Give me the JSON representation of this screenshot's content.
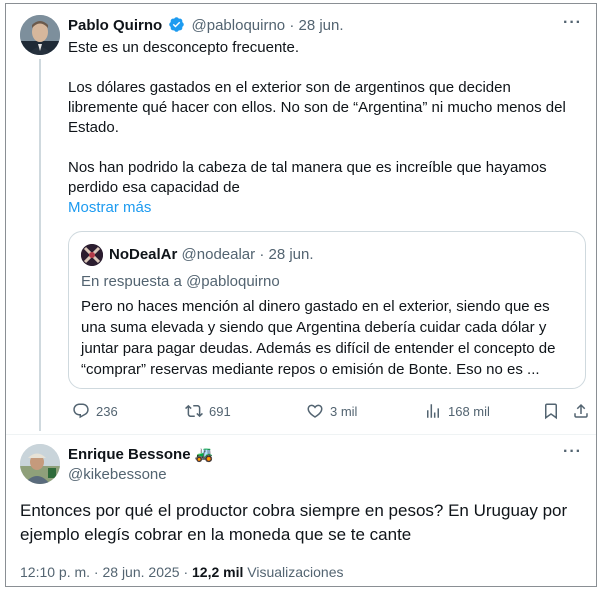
{
  "parent": {
    "name": "Pablo Quirno",
    "handle": "@pabloquirno",
    "sep": "·",
    "date": "28 jun.",
    "text_p1": "Este es un desconcepto frecuente.",
    "text_p2": "Los dólares gastados en el exterior son de argentinos que deciden libremente qué hacer con ellos. No son de “Argentina” ni mucho menos del Estado.",
    "text_p3": "Nos han podrido la cabeza de tal manera que es increíble que hayamos perdido esa capacidad de",
    "show_more": "Mostrar más",
    "more_icon": "more-icon",
    "verified_color": "#1d9bf0"
  },
  "quote": {
    "name": "NoDealAr",
    "handle": "@nodealar",
    "sep": "·",
    "date": "28 jun.",
    "reply_to": "En respuesta a @pabloquirno",
    "body": "Pero no haces mención al dinero gastado en el exterior, siendo que es una suma elevada y siendo que Argentina debería cuidar cada dólar y juntar para pagar deudas. Además es difícil de entender el concepto de “comprar” reservas mediante repos o emisión de Bonte. Eso no es ..."
  },
  "actions": {
    "replies": "236",
    "reposts": "691",
    "likes": "3 mil",
    "views": "168 mil",
    "icons": [
      "reply-icon",
      "repost-icon",
      "like-icon",
      "views-icon",
      "bookmark-icon",
      "share-icon"
    ]
  },
  "reply": {
    "name": "Enrique Bessone",
    "emoji": "🚜",
    "handle": "@kikebessone",
    "text": "Entonces por qué el productor cobra siempre en pesos? En Uruguay por ejemplo elegís cobrar en la moneda que se te cante",
    "time": "12:10 p. m. · 28 jun. 2025 · ",
    "views_count": "12,2 mil",
    "views_label": " Visualizaciones"
  },
  "colors": {
    "accent": "#1d9bf0",
    "text": "#0f1419",
    "muted": "#536471",
    "border": "#cfd9de"
  }
}
